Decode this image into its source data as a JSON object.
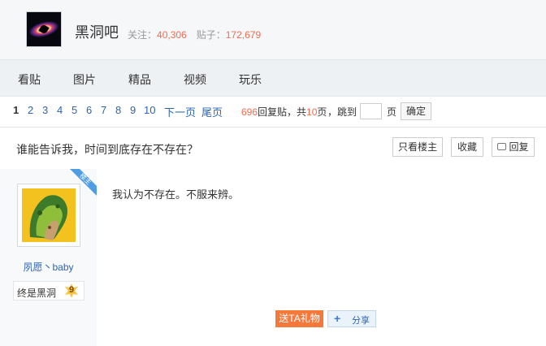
{
  "header": {
    "forum_name": "黑洞吧",
    "follow_label": "关注：",
    "follow_count": "40,306",
    "posts_label": "贴子：",
    "posts_count": "172,679",
    "logo_icon": "black-hole-logo"
  },
  "tabs": [
    "看贴",
    "图片",
    "精品",
    "视频",
    "玩乐"
  ],
  "pager": {
    "pages": [
      "1",
      "2",
      "3",
      "4",
      "5",
      "6",
      "7",
      "8",
      "9",
      "10"
    ],
    "current_page": "1",
    "next_label": "下一页",
    "last_label": "尾页",
    "reply_count": "696",
    "reply_text": "回复贴，共",
    "total_pages": "10",
    "page_unit": "页",
    "jump_label": "，跳到",
    "jump_value": "",
    "jump_unit": "页",
    "confirm_label": "确定"
  },
  "thread": {
    "title": "谁能告诉我，时间到底存在不存在？",
    "only_op_label": "只看楼主",
    "favorite_label": "收藏",
    "reply_label": "回复"
  },
  "post": {
    "op_tag": "楼主",
    "username": "夙愿丶baby",
    "badge_text": "终是黑洞",
    "level": "9",
    "content": "我认为不存在。不服来辨。",
    "gift_label": "送TA礼物",
    "share_label": "分享"
  },
  "colors": {
    "link": "#2d64b3",
    "accent": "#f26c4f",
    "gift": "#f5793a",
    "op_tag": "#4f9ee3"
  }
}
